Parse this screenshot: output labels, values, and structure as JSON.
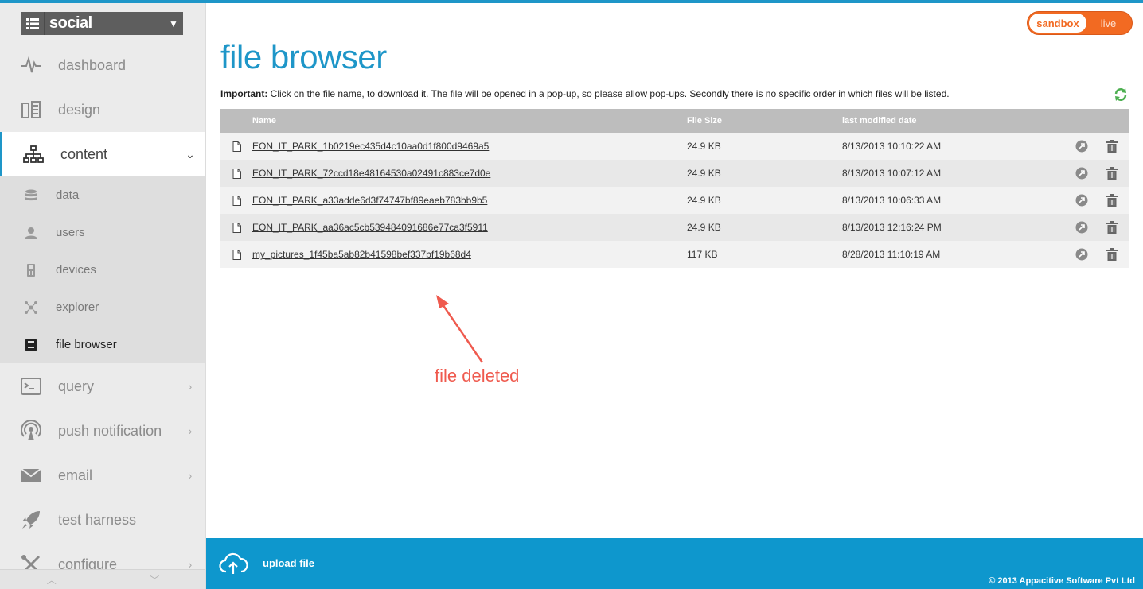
{
  "app_selector": {
    "name": "social"
  },
  "env_toggle": {
    "sandbox": "sandbox",
    "live": "live"
  },
  "nav": {
    "dashboard": "dashboard",
    "design": "design",
    "content": "content",
    "query": "query",
    "push_notification": "push notification",
    "email": "email",
    "test_harness": "test harness",
    "configure": "configure"
  },
  "subnav": {
    "data": "data",
    "users": "users",
    "devices": "devices",
    "explorer": "explorer",
    "file_browser": "file browser"
  },
  "page": {
    "title": "file browser",
    "notice_strong": "Important:",
    "notice_text": " Click on the file name, to download it. The file will be opened in a pop-up, so please allow pop-ups. Secondly there is no specific order in which files will be listed."
  },
  "table": {
    "headers": {
      "name": "Name",
      "size": "File Size",
      "date": "last modified date"
    },
    "rows": [
      {
        "name": "EON_IT_PARK_1b0219ec435d4c10aa0d1f800d9469a5",
        "size": "24.9 KB",
        "date": "8/13/2013 10:10:22 AM"
      },
      {
        "name": "EON_IT_PARK_72ccd18e48164530a02491c883ce7d0e",
        "size": "24.9 KB",
        "date": "8/13/2013 10:07:12 AM"
      },
      {
        "name": "EON_IT_PARK_a33adde6d3f74747bf89eaeb783bb9b5",
        "size": "24.9 KB",
        "date": "8/13/2013 10:06:33 AM"
      },
      {
        "name": "EON_IT_PARK_aa36ac5cb539484091686e77ca3f5911",
        "size": "24.9 KB",
        "date": "8/13/2013 12:16:24 PM"
      },
      {
        "name": "my_pictures_1f45ba5ab82b41598bef337bf19b68d4",
        "size": "117 KB",
        "date": "8/28/2013 11:10:19 AM"
      }
    ]
  },
  "annotation": {
    "text": "file deleted"
  },
  "footer": {
    "upload_label": "upload file",
    "copyright": "© 2013 Appacitive Software Pvt Ltd"
  },
  "colors": {
    "accent": "#1e96c8",
    "footer": "#0e97cd",
    "env": "#f26a22",
    "annotation": "#ef5a4e"
  }
}
